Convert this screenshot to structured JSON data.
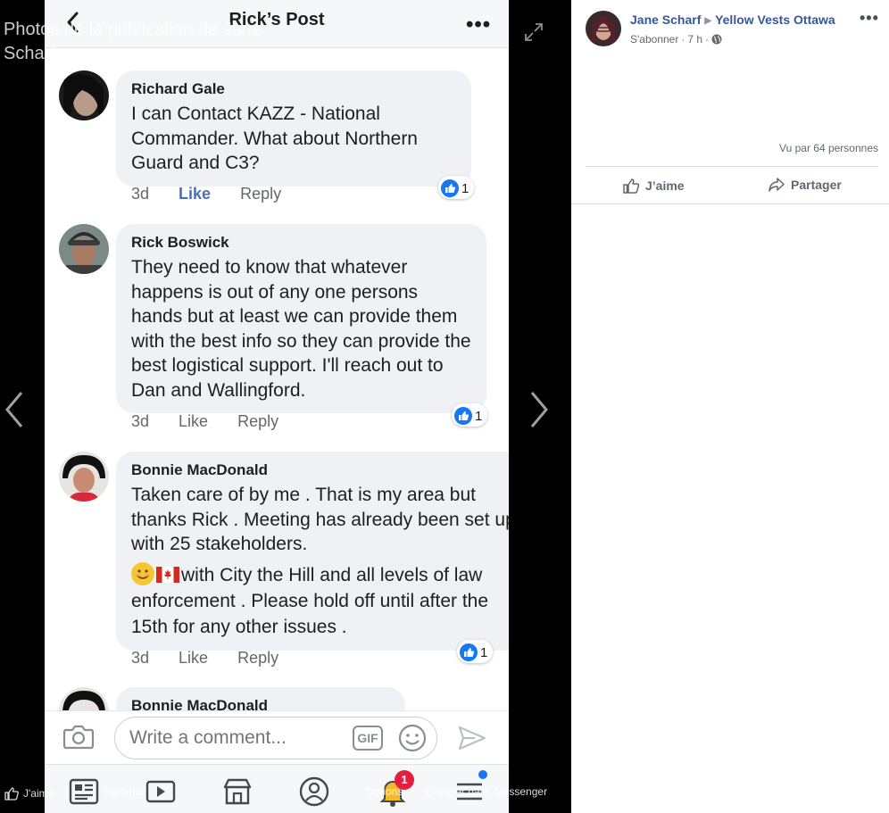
{
  "viewer": {
    "title": "Photos de la publication de Jane Scharf",
    "footer": {
      "like": "J'aime",
      "share": "Partager",
      "options": "Options",
      "send": "Envoyer dans Messenger"
    }
  },
  "phone": {
    "header_title": "Rick’s Post",
    "comments": [
      {
        "author": "Richard Gale",
        "text": "I can Contact KAZZ - National Commander.    What about Northern Guard and C3?",
        "time": "3d",
        "like": "Like",
        "reply": "Reply",
        "reactions": "1",
        "liked": true
      },
      {
        "author": "Rick Boswick",
        "text": "They need to know that whatever happens is out of any one persons hands but at least we can provide them with the best info so they can provide the best  logistical support. I'll reach out to Dan and Wallingford.",
        "time": "3d",
        "like": "Like",
        "reply": "Reply",
        "reactions": "1",
        "liked": false
      },
      {
        "author": "Bonnie MacDonald",
        "text": "Taken care of by me .  That is my area but thanks Rick .  Meeting has already been set up with 25 stakeholders.",
        "text2": "with City the Hill and all levels of law enforcement .  Please hold off until after the 15th for any other issues .",
        "time": "3d",
        "like": "Like",
        "reply": "Reply",
        "reactions": "1",
        "liked": false
      },
      {
        "author": "Bonnie MacDonald"
      }
    ],
    "composer": {
      "placeholder": "Write a comment...",
      "gif": "GIF"
    },
    "notification_count": "1"
  },
  "panel": {
    "poster_name": "Jane Scharf",
    "group_name": "Yellow Vests Ottawa",
    "subscribe": "S'abonner",
    "time": "7 h",
    "seen_by": "Vu par 64 personnes",
    "like_label": "J’aime",
    "share_label": "Partager"
  },
  "colors": {
    "facebook_blue": "#1877f2",
    "link_blue": "#365899",
    "bubble": "#f0f1f4",
    "notification_red": "#e41e3f"
  }
}
